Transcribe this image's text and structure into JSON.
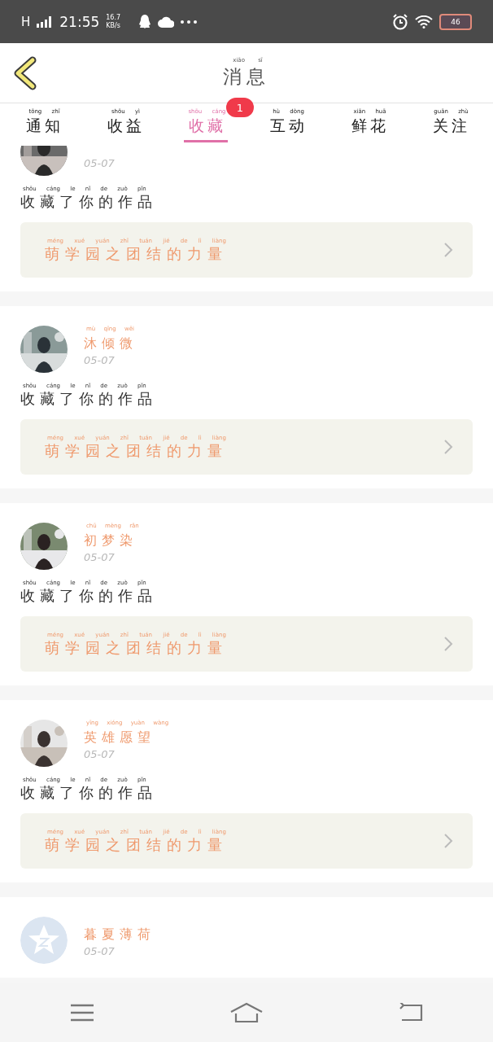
{
  "status_bar": {
    "network": "H",
    "time": "21:55",
    "speed": "16.7",
    "speed_unit": "KB/s",
    "battery": "46"
  },
  "header": {
    "title": "消息",
    "title_pinyin": "xiāo sī"
  },
  "tabs": [
    {
      "label": "通知",
      "pinyin": "tōng zhī",
      "selected": false
    },
    {
      "label": "收益",
      "pinyin": "shōu yì",
      "selected": false
    },
    {
      "label": "收藏",
      "pinyin": "shōu cáng",
      "selected": true,
      "badge": "1"
    },
    {
      "label": "互动",
      "pinyin": "hù dòng",
      "selected": false
    },
    {
      "label": "鲜花",
      "pinyin": "xiān huā",
      "selected": false
    },
    {
      "label": "关注",
      "pinyin": "guān zhù",
      "selected": false
    }
  ],
  "messages": [
    {
      "date": "05-07",
      "text": "收藏了你的作品",
      "text_pinyin": "shōu cáng le nǐ de zuò pǐn",
      "work": "萌学园之团结的力量",
      "work_pinyin": "méng xué yuán zhī tuán jié de lì liàng"
    },
    {
      "name": "沐倾微",
      "name_pinyin": "mù qīng wēi",
      "date": "05-07",
      "text": "收藏了你的作品",
      "text_pinyin": "shōu cáng le nǐ de zuò pǐn",
      "work": "萌学园之团结的力量",
      "work_pinyin": "méng xué yuán zhī tuán jié de lì liàng"
    },
    {
      "name": "初梦染",
      "name_pinyin": "chū mèng rǎn",
      "date": "05-07",
      "text": "收藏了你的作品",
      "text_pinyin": "shōu cáng le nǐ de zuò pǐn",
      "work": "萌学园之团结的力量",
      "work_pinyin": "méng xué yuán zhī tuán jié de lì liàng"
    },
    {
      "name": "英雄愿望",
      "name_pinyin": "yīng xióng yuàn wàng",
      "date": "05-07",
      "text": "收藏了你的作品",
      "text_pinyin": "shōu cáng le nǐ de zuò pǐn",
      "work": "萌学园之团结的力量",
      "work_pinyin": "méng xué yuán zhī tuán jié de lì liàng"
    },
    {
      "avatar": {
        "kind": "default"
      },
      "name": "暮夏薄荷",
      "date": "05-07"
    }
  ]
}
